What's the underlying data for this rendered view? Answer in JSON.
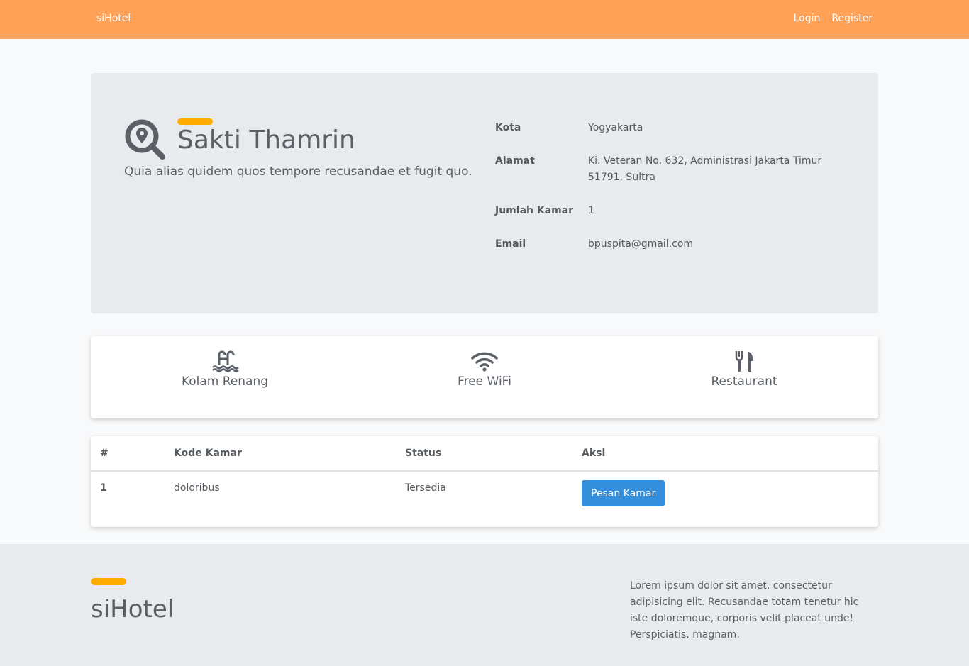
{
  "navbar": {
    "brand": "siHotel",
    "links": {
      "login": "Login",
      "register": "Register"
    },
    "bg_color": "#ffa258"
  },
  "hotel": {
    "icon": "search-location-icon",
    "name": "Sakti Thamrin",
    "description": "Quia alias quidem quos tempore recusandae et fugit quo.",
    "info": [
      {
        "label": "Kota",
        "value": "Yogyakarta"
      },
      {
        "label": "Alamat",
        "value": "Ki. Veteran No. 632, Administrasi Jakarta Timur 51791, Sultra"
      },
      {
        "label": "Jumlah Kamar",
        "value": "1"
      },
      {
        "label": "Email",
        "value": "bpuspita@gmail.com"
      }
    ]
  },
  "facilities": [
    {
      "icon": "swimming-pool-icon",
      "label": "Kolam Renang"
    },
    {
      "icon": "wifi-icon",
      "label": "Free WiFi"
    },
    {
      "icon": "utensils-icon",
      "label": "Restaurant"
    }
  ],
  "rooms_table": {
    "headers": [
      "#",
      "Kode Kamar",
      "Status",
      "Aksi"
    ],
    "rows": [
      {
        "no": "1",
        "kode": "doloribus",
        "status": "Tersedia",
        "action": "Pesan Kamar"
      }
    ]
  },
  "footer": {
    "brand": "siHotel",
    "text": "Lorem ipsum dolor sit amet, consectetur adipisicing elit. Recusandae totam tenetur hic iste doloremque, corporis velit placeat unde! Perspiciatis, magnam."
  },
  "colors": {
    "accent": "#ffaa00",
    "button": "#3490dc"
  }
}
